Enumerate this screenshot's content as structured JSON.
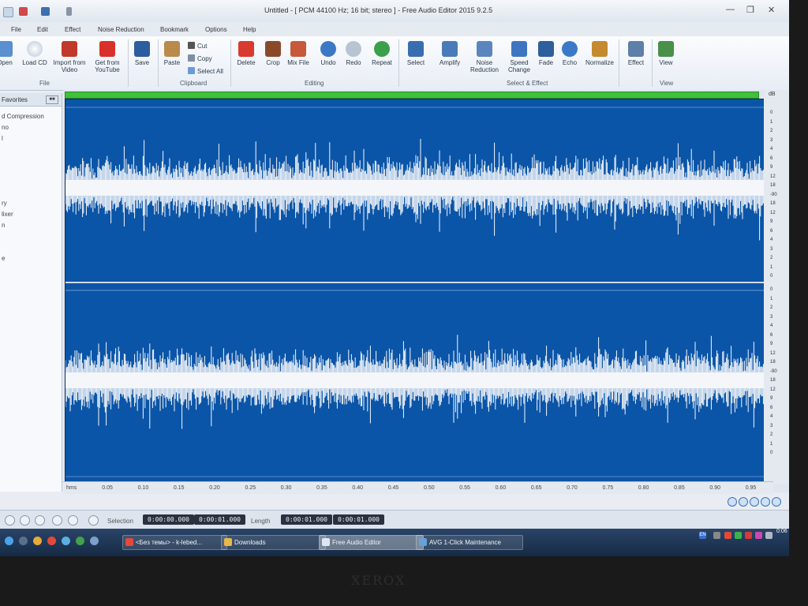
{
  "window": {
    "title": "Untitled - [ PCM 44100 Hz; 16 bit; stereo ] - Free Audio Editor 2015 9.2.5"
  },
  "menu": {
    "tabs": [
      "File",
      "Edit",
      "Effect",
      "Noise Reduction",
      "Bookmark",
      "Options",
      "Help"
    ]
  },
  "ribbon": {
    "file": {
      "open": "Open",
      "load_cd": "Load CD",
      "import_video": "Import from Video",
      "youtube": "Get from YouTube",
      "group": "File"
    },
    "save": "Save",
    "clipboard": {
      "paste": "Paste",
      "cut": "Cut",
      "copy": "Copy",
      "select_all": "Select All",
      "group": "Clipboard"
    },
    "editing": {
      "delete": "Delete",
      "crop": "Crop",
      "mix_file": "Mix File",
      "undo": "Undo",
      "redo": "Redo",
      "repeat": "Repeat",
      "group": "Editing"
    },
    "select_effect": {
      "select": "Select",
      "amplify": "Amplify",
      "noise_reduction": "Noise Reduction",
      "speed_change": "Speed Change",
      "fade": "Fade",
      "echo": "Echo",
      "normalize": "Normalize",
      "group": "Select & Effect"
    },
    "effect": "Effect",
    "view": {
      "view": "View",
      "group": "View"
    }
  },
  "sidebar": {
    "header": "Favorites",
    "items": [
      "d Compression",
      "no",
      "l",
      "ry",
      "lixer",
      "n",
      "e"
    ]
  },
  "editor": {
    "db_unit": "dB",
    "db_ticks_upper": [
      "0",
      "1",
      "2",
      "3",
      "4",
      "6",
      "9",
      "12",
      "18",
      "-90",
      "18",
      "12",
      "9",
      "6",
      "4",
      "3",
      "2",
      "1",
      "0"
    ],
    "db_ticks_lower": [
      "0",
      "1",
      "2",
      "3",
      "4",
      "6",
      "9",
      "12",
      "18",
      "-90",
      "18",
      "12",
      "9",
      "6",
      "4",
      "3",
      "2",
      "1",
      "0"
    ]
  },
  "time_ruler": {
    "labels": [
      "hms",
      "0.05",
      "0.10",
      "0.15",
      "0.20",
      "0.25",
      "0.30",
      "0.35",
      "0.40",
      "0.45",
      "0.50",
      "0.55",
      "0.60",
      "0.65",
      "0.70",
      "0.75",
      "0.80",
      "0.85",
      "0.90",
      "0.95"
    ]
  },
  "status": {
    "selection_label": "Selection",
    "selection_start": "0:00:00.000",
    "selection_end": "0:00:01.000",
    "length_label": "Length",
    "length_start": "0:00:01.000",
    "length_end": "0:00:01.000"
  },
  "taskbar": {
    "tasks": [
      "<Без темы> - k-lebed...",
      "Downloads",
      "Free Audio Editor",
      "AVG 1-Click Maintenance"
    ],
    "clock": "0:06",
    "lang": "EN"
  },
  "bezel": {
    "brand": "XEROX"
  },
  "colors": {
    "wave_bg": "#0b55a8",
    "wave_fg": "#f4f6fa",
    "overview": "#3fc13a",
    "taskbar": "#1c3353"
  }
}
